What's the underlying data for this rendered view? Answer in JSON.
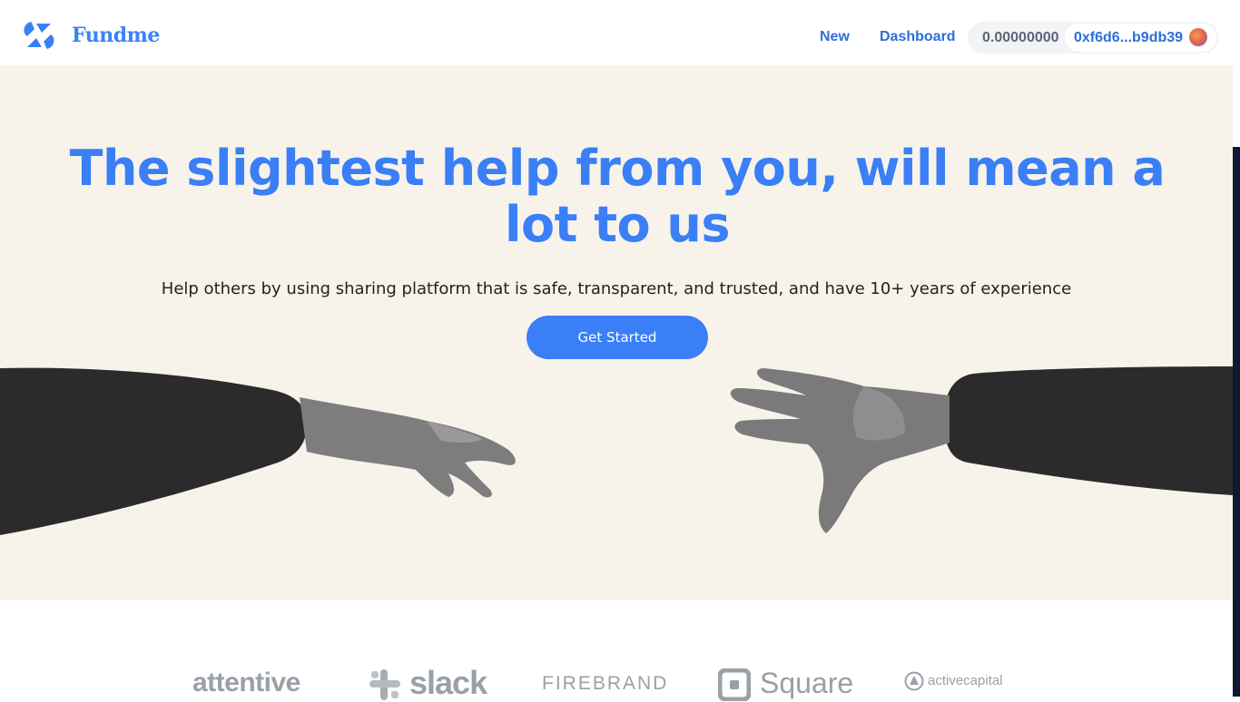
{
  "header": {
    "brand": "Fundme",
    "nav": {
      "new_label": "New",
      "dashboard_label": "Dashboard"
    },
    "wallet": {
      "balance": "0.00000000",
      "address": "0xf6d6...b9db39"
    }
  },
  "hero": {
    "title": "The slightest help from you, will mean a lot to us",
    "subtitle": "Help others by using sharing platform that is safe, transparent, and trusted, and have 10+ years of experience",
    "cta_label": "Get Started"
  },
  "partners": {
    "attentive": "attentive",
    "slack": "slack",
    "firebrand": "FIREBRAND",
    "square": "Square",
    "activecapital": "activecapital"
  },
  "colors": {
    "accent": "#3a7ff6",
    "hero_background": "#f7f3ea",
    "nav_link": "#2e6fd8",
    "partner_logo": "#9aa0a6"
  },
  "icons": {
    "logo": "fundme-logo-icon",
    "wallet_avatar": "wallet-avatar-icon"
  }
}
